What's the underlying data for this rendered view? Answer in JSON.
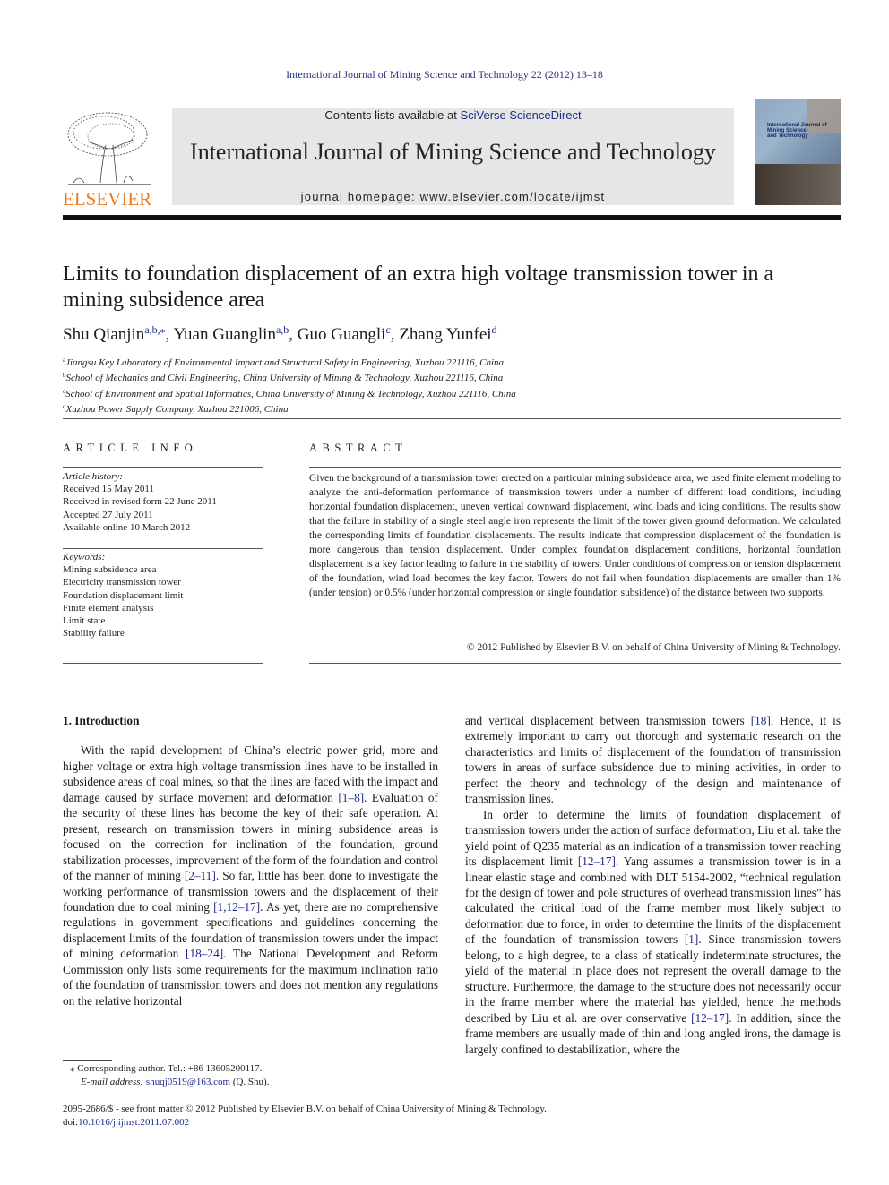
{
  "running_head": "International Journal of Mining Science and Technology 22 (2012) 13–18",
  "masthead": {
    "publisher_logo_text": "ELSEVIER",
    "contents_prefix": "Contents lists available at ",
    "contents_link": "SciVerse ScienceDirect",
    "journal_title": "International Journal of Mining Science and Technology",
    "homepage_prefix": "journal homepage: ",
    "homepage_url": "www.elsevier.com/locate/ijmst",
    "cover_title_lines": [
      "International Journal of",
      "Mining Science",
      "and Technology"
    ],
    "colors": {
      "logo_orange": "#f07a1e",
      "link_blue": "#1f2a87",
      "banner_gray": "#e6e6e6"
    }
  },
  "article": {
    "title": "Limits to foundation displacement of an extra high voltage transmission tower in a mining subsidence area",
    "authors": [
      {
        "name": "Shu Qianjin",
        "sup": "a,b,⁎",
        "sep": ", "
      },
      {
        "name": "Yuan Guanglin",
        "sup": "a,b",
        "sep": ", "
      },
      {
        "name": "Guo Guangli",
        "sup": "c",
        "sep": ", "
      },
      {
        "name": "Zhang Yunfei",
        "sup": "d",
        "sep": ""
      }
    ],
    "affiliations": [
      {
        "key": "a",
        "text": "Jiangsu Key Laboratory of Environmental Impact and Structural Safety in Engineering, Xuzhou 221116, China"
      },
      {
        "key": "b",
        "text": "School of Mechanics and Civil Engineering, China University of Mining & Technology, Xuzhou 221116, China"
      },
      {
        "key": "c",
        "text": "School of Environment and Spatial Informatics, China University of Mining & Technology, Xuzhou 221116, China"
      },
      {
        "key": "d",
        "text": "Xuzhou Power Supply Company, Xuzhou 221006, China"
      }
    ]
  },
  "article_info": {
    "heading": "ARTICLE INFO",
    "history_label": "Article history:",
    "history": [
      "Received 15 May 2011",
      "Received in revised form 22 June 2011",
      "Accepted 27 July 2011",
      "Available online 10 March 2012"
    ],
    "keywords_label": "Keywords:",
    "keywords": [
      "Mining subsidence area",
      "Electricity transmission tower",
      "Foundation displacement limit",
      "Finite element analysis",
      "Limit state",
      "Stability failure"
    ]
  },
  "abstract": {
    "heading": "ABSTRACT",
    "text": "Given the background of a transmission tower erected on a particular mining subsidence area, we used finite element modeling to analyze the anti-deformation performance of transmission towers under a number of different load conditions, including horizontal foundation displacement, uneven vertical downward displacement, wind loads and icing conditions. The results show that the failure in stability of a single steel angle iron represents the limit of the tower given ground deformation. We calculated the corresponding limits of foundation displacements. The results indicate that compression displacement of the foundation is more dangerous than tension displacement. Under complex foundation displacement conditions, horizontal foundation displacement is a key factor leading to failure in the stability of towers. Under conditions of compression or tension displacement of the foundation, wind load becomes the key factor. Towers do not fail when foundation displacements are smaller than 1% (under tension) or 0.5% (under horizontal compression or single foundation subsidence) of the distance between two supports.",
    "copyright": "© 2012 Published by Elsevier B.V. on behalf of China University of Mining & Technology."
  },
  "body": {
    "section_heading": "1. Introduction",
    "left_col": {
      "p1": [
        {
          "t": "With the rapid development of China’s electric power grid, more and higher voltage or extra high voltage transmission lines have to be installed in subsidence areas of coal mines, so that the lines are faced with the impact and damage caused by surface movement and deformation "
        },
        {
          "ref": "[1–8]"
        },
        {
          "t": ". Evaluation of the security of these lines has become the key of their safe operation. At present, research on transmission towers in mining subsidence areas is focused on the correction for inclination of the foundation, ground stabilization processes, improvement of the form of the foundation and control of the manner of mining "
        },
        {
          "ref": "[2–11]"
        },
        {
          "t": ". So far, little has been done to investigate the working performance of transmission towers and the displacement of their foundation due to coal mining "
        },
        {
          "ref": "[1,12–17]"
        },
        {
          "t": ". As yet, there are no comprehensive regulations in government specifications and guidelines concerning the displacement limits of the foundation of transmission towers under the impact of mining deformation "
        },
        {
          "ref": "[18–24]"
        },
        {
          "t": ". The National Development and Reform Commission only lists some requirements for the maximum inclination ratio of the foundation of transmission towers and does not mention any regulations on the relative horizontal"
        }
      ]
    },
    "right_col": {
      "p1": [
        {
          "t": "and vertical displacement between transmission towers "
        },
        {
          "ref": "[18]"
        },
        {
          "t": ". Hence, it is extremely important to carry out thorough and systematic research on the characteristics and limits of displacement of the foundation of transmission towers in areas of surface subsidence due to mining activities, in order to perfect the theory and technology of the design and maintenance of transmission lines."
        }
      ],
      "p2": [
        {
          "t": "In order to determine the limits of foundation displacement of transmission towers under the action of surface deformation, Liu et al. take the yield point of Q235 material as an indication of a transmission tower reaching its displacement limit "
        },
        {
          "ref": "[12–17]"
        },
        {
          "t": ". Yang assumes a transmission tower is in a linear elastic stage and combined with DLT 5154-2002, “technical regulation for the design of tower and pole structures of overhead transmission lines” has calculated the critical load of the frame member most likely subject to deformation due to force, in order to determine the limits of the displacement of the foundation of transmission towers "
        },
        {
          "ref": "[1]"
        },
        {
          "t": ". Since transmission towers belong, to a high degree, to a class of statically indeterminate structures, the yield of the material in place does not represent the overall damage to the structure. Furthermore, the damage to the structure does not necessarily occur in the frame member where the material has yielded, hence the methods described by Liu et al. are over conservative "
        },
        {
          "ref": "[12–17]"
        },
        {
          "t": ". In addition, since the frame members are usually made of thin and long angled irons, the damage is largely confined to destabilization, where the"
        }
      ]
    }
  },
  "footnote": {
    "marker": "⁎",
    "corresponding": "Corresponding author. Tel.: +86 13605200117.",
    "email_label": "E-mail address:",
    "email": "shuqj0519@163.com",
    "email_suffix": " (Q. Shu)."
  },
  "imprint": {
    "line1": "2095-2686/$ - see front matter © 2012 Published by Elsevier B.V. on behalf of China University of Mining & Technology.",
    "doi_prefix": "doi:",
    "doi": "10.1016/j.ijmst.2011.07.002"
  }
}
